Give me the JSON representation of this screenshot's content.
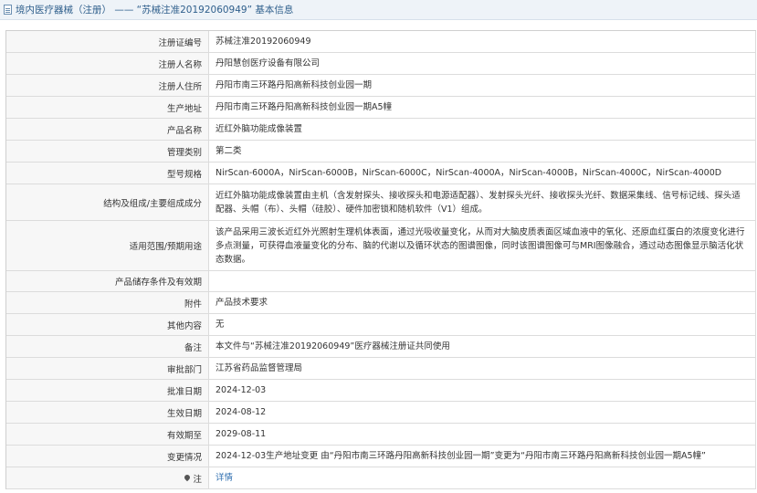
{
  "header": {
    "title": "境内医疗器械（注册） —— “苏械注准20192060949” 基本信息"
  },
  "rows": [
    {
      "label": "注册证编号",
      "value": "苏械注准20192060949"
    },
    {
      "label": "注册人名称",
      "value": "丹阳慧创医疗设备有限公司"
    },
    {
      "label": "注册人住所",
      "value": "丹阳市南三环路丹阳高新科技创业园一期"
    },
    {
      "label": "生产地址",
      "value": "丹阳市南三环路丹阳高新科技创业园一期A5幢"
    },
    {
      "label": "产品名称",
      "value": "近红外脑功能成像装置"
    },
    {
      "label": "管理类别",
      "value": "第二类"
    },
    {
      "label": "型号规格",
      "value": "NirScan-6000A，NirScan-6000B，NirScan-6000C，NirScan-4000A，NirScan-4000B，NirScan-4000C，NirScan-4000D"
    },
    {
      "label": "结构及组成/主要组成成分",
      "value": "近红外脑功能成像装置由主机（含发射探头、接收探头和电源适配器）、发射探头光纤、接收探头光纤、数据采集线、信号标记线、探头适配器、头帽（布）、头帽（硅胶）、硬件加密锁和随机软件（V1）组成。"
    },
    {
      "label": "适用范围/预期用途",
      "value": "该产品采用三波长近红外光照射生理机体表面，通过光吸收量变化，从而对大脑皮质表面区域血液中的氧化、还原血红蛋白的浓度变化进行多点测量，可获得血液量变化的分布、脑的代谢以及循环状态的图谱图像，同时该图谱图像可与MRI图像融合，通过动态图像显示脑活化状态数据。"
    },
    {
      "label": "产品储存条件及有效期",
      "value": ""
    },
    {
      "label": "附件",
      "value": "产品技术要求"
    },
    {
      "label": "其他内容",
      "value": "无"
    },
    {
      "label": "备注",
      "value": "本文件与“苏械注准20192060949”医疗器械注册证共同使用"
    },
    {
      "label": "审批部门",
      "value": "江苏省药品监督管理局"
    },
    {
      "label": "批准日期",
      "value": "2024-12-03"
    },
    {
      "label": "生效日期",
      "value": "2024-08-12"
    },
    {
      "label": "有效期至",
      "value": "2029-08-11"
    },
    {
      "label": "变更情况",
      "value": "2024-12-03生产地址变更 由“丹阳市南三环路丹阳高新科技创业园一期”变更为“丹阳市南三环路丹阳高新科技创业园一期A5幢”"
    }
  ],
  "footer_row": {
    "label": "注",
    "link": "详情",
    "icon": "pin-icon"
  }
}
